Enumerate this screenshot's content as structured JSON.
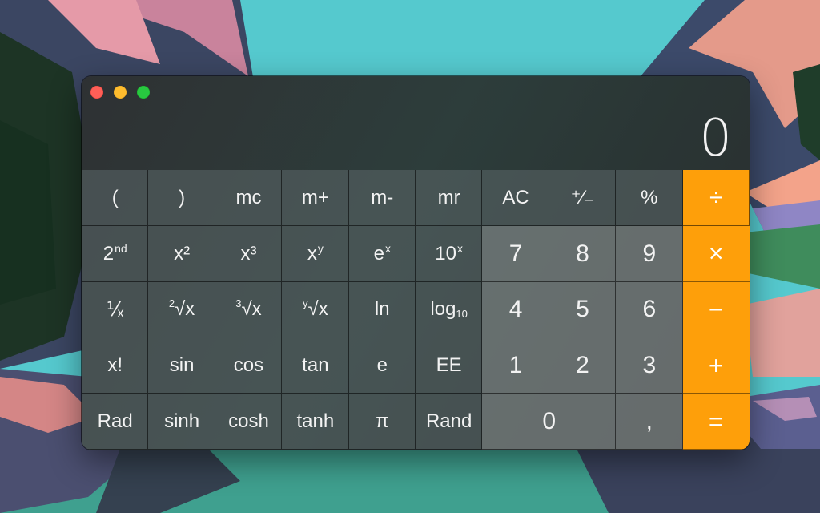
{
  "window": {
    "controls": {
      "close": "close-button",
      "minimize": "minimize-button",
      "maximize": "maximize-button"
    },
    "colors": {
      "close": "#ff5f57",
      "minimize": "#febc2e",
      "maximize": "#28c840"
    }
  },
  "display": {
    "value": "0"
  },
  "keys": {
    "row1": [
      "(",
      ")",
      "mc",
      "m+",
      "m-",
      "mr",
      "AC",
      "⁺∕₋",
      "%",
      "÷"
    ],
    "row2": {
      "second": {
        "base": "2",
        "sup": "nd"
      },
      "x2": {
        "base": "x",
        "sup": "²"
      },
      "x3": {
        "base": "x",
        "sup": "³"
      },
      "xy": {
        "base": "x",
        "sup": "y"
      },
      "ex": {
        "base": "e",
        "sup": "x"
      },
      "tenx": {
        "base": "10",
        "sup": "x"
      },
      "seven": "7",
      "eight": "8",
      "nine": "9",
      "multiply": "×"
    },
    "row3": {
      "reciprocal": "⅟ₓ",
      "sqrt2": {
        "pre": "2",
        "base": "√x"
      },
      "sqrt3": {
        "pre": "3",
        "base": "√x"
      },
      "sqrty": {
        "pre": "y",
        "base": "√x"
      },
      "ln": "ln",
      "log10": {
        "base": "log",
        "sub": "10"
      },
      "four": "4",
      "five": "5",
      "six": "6",
      "minus": "−"
    },
    "row4": [
      "x!",
      "sin",
      "cos",
      "tan",
      "e",
      "EE",
      "1",
      "2",
      "3",
      "+"
    ],
    "row5": {
      "rad": "Rad",
      "sinh": "sinh",
      "cosh": "cosh",
      "tanh": "tanh",
      "pi": "π",
      "rand": "Rand",
      "zero": "0",
      "decimal": ",",
      "equals": "="
    }
  },
  "colors": {
    "operator": "#fe9f0a",
    "display_text": "#f2f2f2"
  }
}
